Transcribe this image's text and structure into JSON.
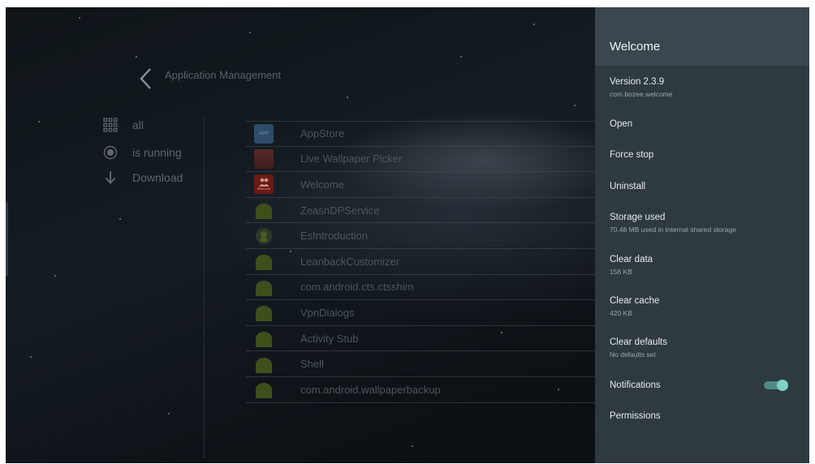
{
  "left": {
    "title": "Application Management",
    "categories": [
      {
        "label": "all",
        "icon": "grid-icon"
      },
      {
        "label": "is running",
        "icon": "radio-target-icon"
      },
      {
        "label": "Download",
        "icon": "download-arrow-icon"
      }
    ]
  },
  "apps": [
    {
      "name": "AppStore",
      "icon": "appstore-icon",
      "icon_text": "APP"
    },
    {
      "name": "Live Wallpaper Picker",
      "icon": "wallpaper-picker-icon"
    },
    {
      "name": "Welcome",
      "icon": "welcome-icon",
      "icon_text": "Welcome"
    },
    {
      "name": "ZeasnDPService",
      "icon": "android-icon"
    },
    {
      "name": "EsIntroduction",
      "icon": "esintroduction-icon"
    },
    {
      "name": "LeanbackCustomizer",
      "icon": "android-icon"
    },
    {
      "name": "com.android.cts.ctsshim",
      "icon": "android-icon"
    },
    {
      "name": "VpnDialogs",
      "icon": "android-icon"
    },
    {
      "name": "Activity Stub",
      "icon": "android-icon"
    },
    {
      "name": "Shell",
      "icon": "android-icon"
    },
    {
      "name": "com.android.wallpaperbackup",
      "icon": "android-icon"
    }
  ],
  "panel": {
    "title": "Welcome",
    "version": {
      "title": "Version 2.3.9",
      "subtitle": "com.bozee.welcome"
    },
    "open": "Open",
    "force_stop": "Force stop",
    "uninstall": "Uninstall",
    "storage": {
      "title": "Storage used",
      "subtitle": "70.48 MB used in Internal shared storage"
    },
    "clear_data": {
      "title": "Clear data",
      "subtitle": "156 KB"
    },
    "clear_cache": {
      "title": "Clear cache",
      "subtitle": "420 KB"
    },
    "clear_defaults": {
      "title": "Clear defaults",
      "subtitle": "No defaults set"
    },
    "notifications": {
      "title": "Notifications",
      "enabled": true
    },
    "permissions": "Permissions"
  },
  "colors": {
    "panel_bg": "#2e3a40",
    "panel_header": "#3a474e",
    "toggle_accent": "#7ed1c5",
    "android_green": "#3e4f1c"
  }
}
